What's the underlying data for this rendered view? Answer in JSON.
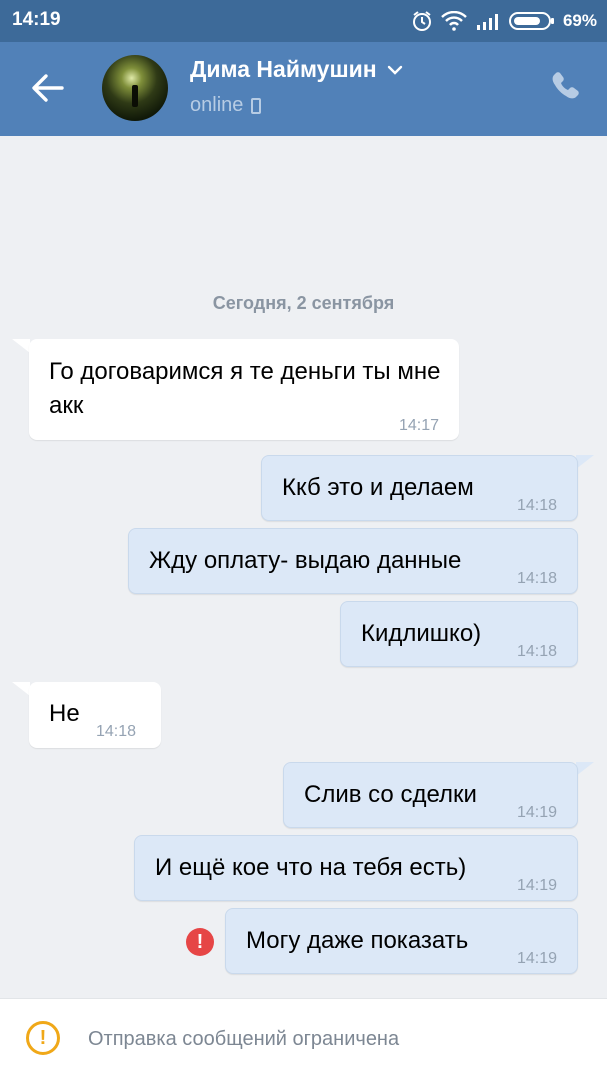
{
  "status_bar": {
    "time": "14:19",
    "battery": "69%"
  },
  "header": {
    "contact_name": "Дима Наймушин",
    "presence": "online"
  },
  "chat": {
    "date_separator": "Сегодня, 2 сентября",
    "messages": [
      {
        "direction": "in",
        "text": "Го договаримся я те деньги ты мне акк",
        "time": "14:17"
      },
      {
        "direction": "out",
        "text": "Ккб это и делаем",
        "time": "14:18"
      },
      {
        "direction": "out",
        "text": "Жду оплату- выдаю данные",
        "time": "14:18"
      },
      {
        "direction": "out",
        "text": "Кидлишко)",
        "time": "14:18"
      },
      {
        "direction": "in",
        "text": "Не",
        "time": "14:18"
      },
      {
        "direction": "out",
        "text": "Слив со сделки",
        "time": "14:19"
      },
      {
        "direction": "out",
        "text": "И ещё кое что на тебя есть)",
        "time": "14:19"
      },
      {
        "direction": "out",
        "text": "Могу даже показать",
        "time": "14:19",
        "error": true
      }
    ],
    "error_mark": "!"
  },
  "footer": {
    "notice": "Отправка сообщений ограничена",
    "warn_mark": "!"
  },
  "colors": {
    "header": "#5181b8",
    "statusbar": "#3d6a99",
    "bubble_out": "#dce8f7",
    "bubble_in": "#ffffff",
    "error": "#e64646",
    "warning": "#f0a818"
  },
  "icons": {
    "back": "arrow-left-icon",
    "call": "phone-icon",
    "dropdown": "chevron-down-icon",
    "device": "mobile-device-icon"
  }
}
